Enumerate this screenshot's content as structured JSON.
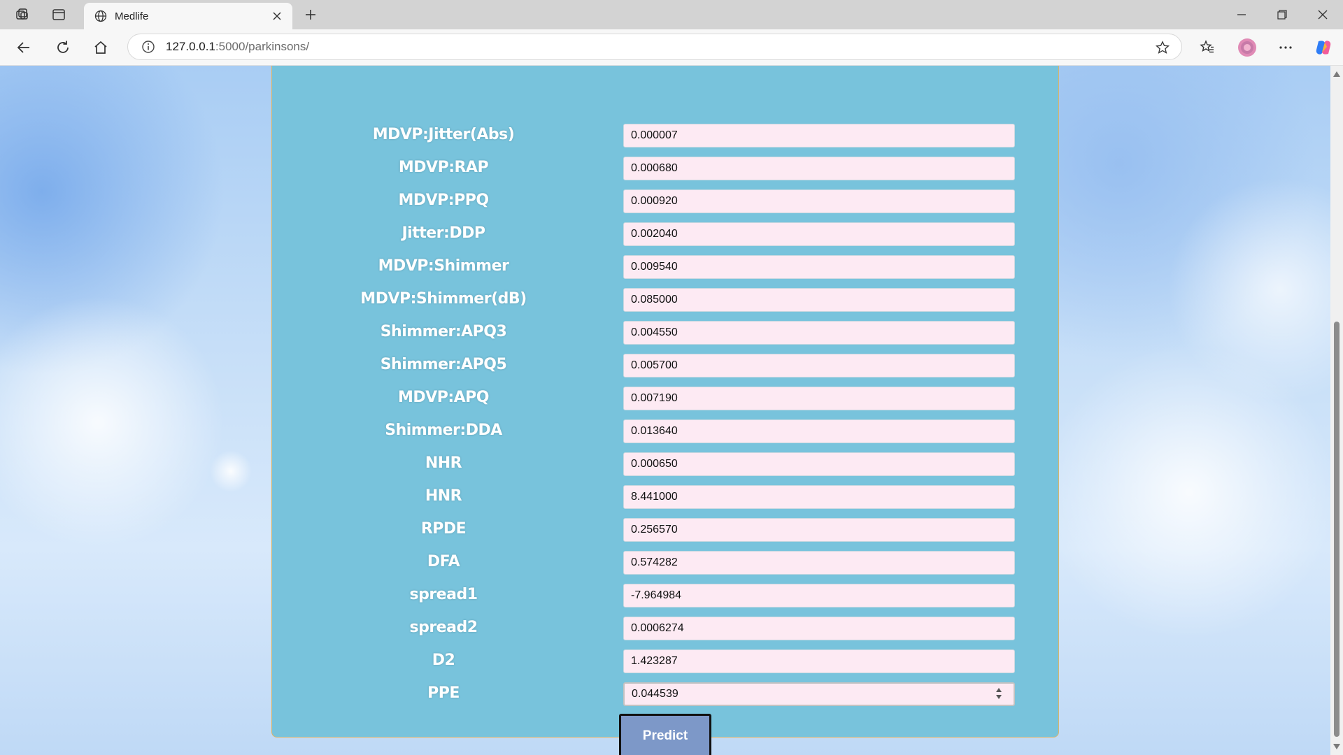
{
  "browser": {
    "tab_title": "Medlife",
    "url_host": "127.0.0.1",
    "url_path": ":5000/parkinsons/"
  },
  "form": {
    "fields": [
      {
        "label": "MDVP:Jitter(Abs)",
        "value": "0.000007"
      },
      {
        "label": "MDVP:RAP",
        "value": "0.000680"
      },
      {
        "label": "MDVP:PPQ",
        "value": "0.000920"
      },
      {
        "label": "Jitter:DDP",
        "value": "0.002040"
      },
      {
        "label": "MDVP:Shimmer",
        "value": "0.009540"
      },
      {
        "label": "MDVP:Shimmer(dB)",
        "value": "0.085000"
      },
      {
        "label": "Shimmer:APQ3",
        "value": "0.004550"
      },
      {
        "label": "Shimmer:APQ5",
        "value": "0.005700"
      },
      {
        "label": "MDVP:APQ",
        "value": "0.007190"
      },
      {
        "label": "Shimmer:DDA",
        "value": "0.013640"
      },
      {
        "label": "NHR",
        "value": "0.000650"
      },
      {
        "label": "HNR",
        "value": "8.441000"
      },
      {
        "label": "RPDE",
        "value": "0.256570"
      },
      {
        "label": "DFA",
        "value": "0.574282"
      },
      {
        "label": "spread1",
        "value": "-7.964984"
      },
      {
        "label": "spread2",
        "value": "0.0006274"
      },
      {
        "label": "D2",
        "value": "1.423287"
      },
      {
        "label": "PPE",
        "value": "0.044539"
      }
    ],
    "submit_label": "Predict"
  },
  "colors": {
    "panel": "#78c3dc",
    "field_bg": "#fdeaf3",
    "button": "#7d98c8"
  }
}
